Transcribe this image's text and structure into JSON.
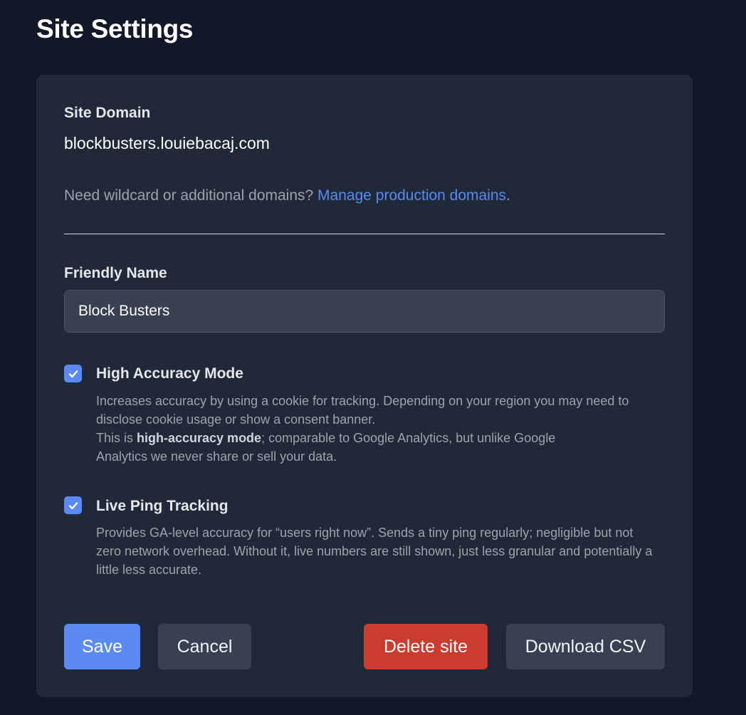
{
  "page": {
    "title": "Site Settings"
  },
  "site_domain": {
    "label": "Site Domain",
    "value": "blockbusters.louiebacaj.com",
    "help_prefix": "Need wildcard or additional domains? ",
    "help_link": "Manage production domains",
    "help_suffix": "."
  },
  "friendly_name": {
    "label": "Friendly Name",
    "value": "Block Busters"
  },
  "high_accuracy": {
    "checked": true,
    "title": "High Accuracy Mode",
    "desc_line1": "Increases accuracy by using a cookie for tracking. Depending on your region you may need to disclose cookie usage or show a consent banner.",
    "desc_pre": "This is ",
    "desc_bold": "high-accuracy mode",
    "desc_post": "; comparable to Google Analytics, but unlike Google Analytics we never share or sell your data."
  },
  "live_ping": {
    "checked": true,
    "title": "Live Ping Tracking",
    "desc": "Provides GA-level accuracy for “users right now”. Sends a tiny ping regularly; negligible but not zero network overhead. Without it, live numbers are still shown, just less granular and potentially a little less accurate."
  },
  "actions": {
    "save": "Save",
    "cancel": "Cancel",
    "delete": "Delete site",
    "download": "Download CSV"
  },
  "colors": {
    "background": "#111827",
    "card": "#1f2937",
    "accent": "#5b8af5",
    "danger": "#cc3b2f"
  },
  "icons": {
    "checkbox": "check-icon"
  }
}
